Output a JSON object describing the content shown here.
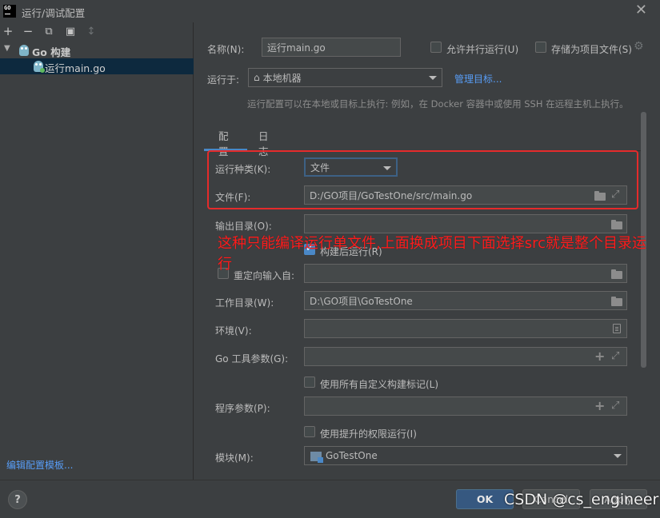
{
  "window": {
    "title": "运行/调试配置",
    "app_icon_text": "GO"
  },
  "toolbar": {
    "add": "+",
    "remove": "−",
    "copy": "⧉",
    "folder_add": "▣",
    "sort": "↕"
  },
  "tree": {
    "group_label": "Go 构建",
    "item_label": "运行main.go"
  },
  "left_link": "编辑配置模板...",
  "form": {
    "name_label": "名称(N):",
    "name_value": "运行main.go",
    "parallel_label": "允许并行运行(U)",
    "store_label": "存储为项目文件(S)",
    "run_on_label": "运行于:",
    "run_on_value": "本地机器",
    "manage_link": "管理目标...",
    "hint": "运行配置可以在本地或目标上执行: 例如，在 Docker 容器中或使用 SSH 在远程主机上执行。",
    "tabs": [
      "配置",
      "日志"
    ],
    "kind_label": "运行种类(K):",
    "kind_value": "文件",
    "file_label": "文件(F):",
    "file_value": "D:/GO项目/GoTestOne/src/main.go",
    "output_label": "输出目录(O):",
    "output_value": "",
    "run_after_build_label": "构建后运行(R)",
    "redirect_label": "重定向输入自:",
    "redirect_value": "",
    "workdir_label": "工作目录(W):",
    "workdir_value": "D:\\GO项目\\GoTestOne",
    "env_label": "环境(V):",
    "env_value": "",
    "go_tool_label": "Go 工具参数(G):",
    "go_tool_value": "",
    "custom_tags_label": "使用所有自定义构建标记(L)",
    "program_args_label": "程序参数(P):",
    "program_args_value": "",
    "elevated_label": "使用提升的权限运行(I)",
    "module_label": "模块(M):",
    "module_value": "GoTestOne"
  },
  "annotation": "这种只能编译运行单文件,上面换成项目下面选择src就是整个目录运行",
  "buttons": {
    "help": "?",
    "ok": "OK",
    "cancel": "Cancel",
    "apply": "Apply"
  },
  "watermark": "CSDN @cs_engineer",
  "colors": {
    "background": "#3c3f41",
    "accent": "#4a88c7",
    "link": "#589df6",
    "annotation_red": "#e52b2b"
  },
  "state": {
    "parallel_checked": false,
    "store_checked": false,
    "run_after_build_checked": true,
    "redirect_checked": false,
    "custom_tags_checked": false,
    "elevated_checked": false,
    "selected_tab": "配置"
  }
}
